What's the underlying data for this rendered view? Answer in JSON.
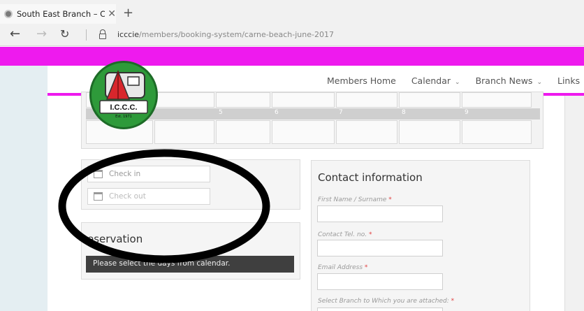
{
  "browser": {
    "tab_title": "South East Branch – Car",
    "tab_close": "✕",
    "new_tab": "+",
    "back": "←",
    "forward": "→",
    "refresh": "↻",
    "url_domain": "icccie",
    "url_path": "/members/booking-system/carne-beach-june-2017"
  },
  "site": {
    "logo_text": "I.C.C.C.",
    "logo_sub": "Est. 1971",
    "menu": [
      {
        "label": "Members Home",
        "chev": ""
      },
      {
        "label": "Calendar",
        "chev": "⌄"
      },
      {
        "label": "Branch News",
        "chev": "⌄"
      },
      {
        "label": "Links",
        "chev": "⌄"
      }
    ]
  },
  "calendar": {
    "day_numbers": [
      "5",
      "6",
      "7",
      "8",
      "9"
    ]
  },
  "booking": {
    "check_in_placeholder": "Check in",
    "check_out_placeholder": "Check out"
  },
  "reservation": {
    "title": "eservation",
    "message": "Please select the days from calendar."
  },
  "contact": {
    "title": "Contact information",
    "fields": [
      {
        "label": "First Name / Surname",
        "required": "*"
      },
      {
        "label": "Contact Tel. no.",
        "required": "*"
      },
      {
        "label": "Email Address",
        "required": "*"
      },
      {
        "label": "Select Branch to Which you are attached:",
        "required": "*"
      }
    ]
  },
  "colors": {
    "accent_magenta": "#ee1aee",
    "logo_green": "#2e9a3a",
    "tent_red": "#d8262c"
  }
}
